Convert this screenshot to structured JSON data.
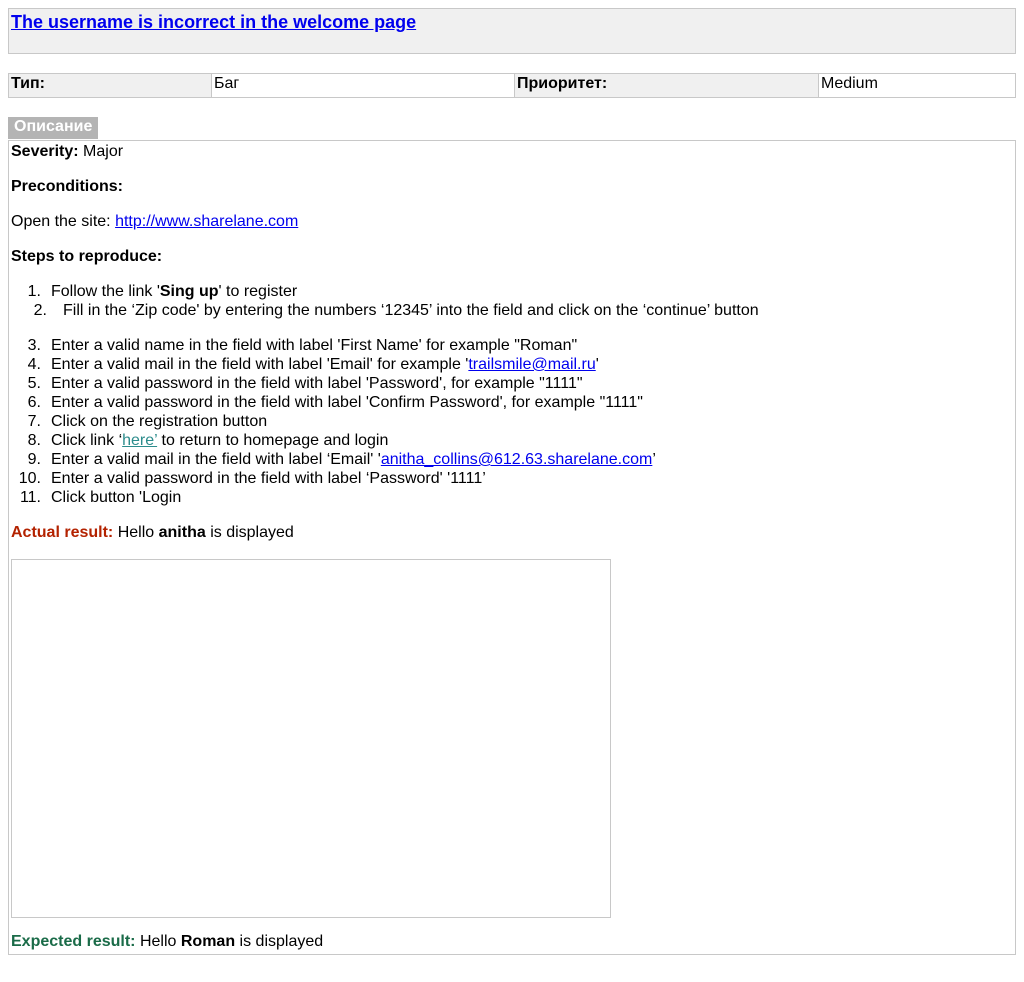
{
  "title": "The username is incorrect in the welcome page",
  "meta": {
    "type_label": "Тип:",
    "type_value": "Баг",
    "priority_label": "Приоритет:",
    "priority_value": "Medium"
  },
  "description": {
    "tab_label": "Описание",
    "severity_label": "Severity:",
    "severity_value": "Major",
    "preconditions_label": "Preconditions:",
    "open_site_text": "Open the site:",
    "site_link": "http://www.sharelane.com",
    "steps_label": "Steps to reproduce:",
    "steps": {
      "s1": {
        "num": "1.",
        "pre": "Follow the link '",
        "bold": "Sing up",
        "post": "' to register"
      },
      "s2": {
        "num": "2.",
        "text": "Fill in the ‘Zip code' by entering the numbers ‘12345’ into the field and click on the ‘continue’ button"
      },
      "s3": {
        "num": "3.",
        "text": "Enter a valid name in the field with label 'First Name' for example \"Roman\""
      },
      "s4": {
        "num": "4.",
        "pre": "Enter a valid mail in the field with label 'Email' for example '",
        "link": "trailsmile@mail.ru",
        "post": "'"
      },
      "s5": {
        "num": "5.",
        "text": "Enter a valid password in the field with label 'Password', for example \"1111\""
      },
      "s6": {
        "num": "6.",
        "text": "Enter a valid password in the field with label 'Confirm Password', for example \"1111\""
      },
      "s7": {
        "num": "7.",
        "text": "Click on the registration button"
      },
      "s8": {
        "num": "8.",
        "pre": "Click link ‘",
        "link": "here’",
        "post": " to return to homepage and login"
      },
      "s9": {
        "num": "9.",
        "pre": "Enter a valid mail in the field with label ‘Email' '",
        "link": "anitha_collins@612.63.sharelane.com",
        "post": "’"
      },
      "s10": {
        "num": "10.",
        "text": "Enter a valid password in the field with label ‘Password' '1111’"
      },
      "s11": {
        "num": "11.",
        "text": "Click button 'Login"
      }
    },
    "actual_label": "Actual result:",
    "actual_pre": "Hello",
    "actual_name": "anitha",
    "actual_post": "is displayed",
    "expected_label": "Expected result:",
    "expected_pre": "Hello",
    "expected_name": "Roman",
    "expected_post": "is displayed"
  },
  "colors": {
    "actual_label": "#b32200",
    "expected_label": "#1a6b48",
    "link": "#0000ee",
    "tab_bg": "#b4b4b4",
    "header_bg": "#f0f0f0"
  }
}
